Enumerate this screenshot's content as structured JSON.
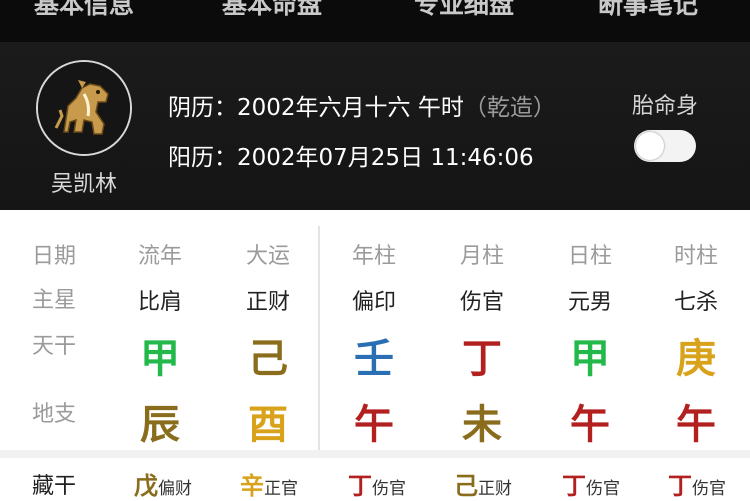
{
  "tabs": [
    "基本信息",
    "基本命盘",
    "专业细盘",
    "断事笔记"
  ],
  "profile": {
    "name": "吴凯林",
    "lunar_label": "阴历：",
    "lunar_value": "2002年六月十六 午时",
    "gender_tag": "（乾造）",
    "solar_label": "阳历：",
    "solar_value": "2002年07月25日 11:46:06",
    "toggle_label": "胎命身",
    "toggle_on": false
  },
  "chart": {
    "headers": [
      "日期",
      "流年",
      "大运",
      "年柱",
      "月柱",
      "日柱",
      "时柱"
    ],
    "row_labels": {
      "main_star": "主星",
      "tian_gan": "天干",
      "di_zhi": "地支",
      "cang_gan": "藏干"
    },
    "main_stars": [
      "比肩",
      "正财",
      "偏印",
      "伤官",
      "元男",
      "七杀"
    ],
    "stems": [
      {
        "char": "甲",
        "color": "#22b84a"
      },
      {
        "char": "己",
        "color": "#8a6d1c"
      },
      {
        "char": "壬",
        "color": "#2a6fb3"
      },
      {
        "char": "丁",
        "color": "#b32020"
      },
      {
        "char": "甲",
        "color": "#22b84a"
      },
      {
        "char": "庚",
        "color": "#d9a21b"
      }
    ],
    "branches": [
      {
        "char": "辰",
        "color": "#8a6d1c"
      },
      {
        "char": "酉",
        "color": "#d9a21b"
      },
      {
        "char": "午",
        "color": "#b32020"
      },
      {
        "char": "未",
        "color": "#8a6d1c"
      },
      {
        "char": "午",
        "color": "#b32020"
      },
      {
        "char": "午",
        "color": "#b32020"
      }
    ],
    "hidden": [
      {
        "stem": "戊",
        "god": "偏财",
        "color": "#8a6d1c"
      },
      {
        "stem": "辛",
        "god": "正官",
        "color": "#d9a21b"
      },
      {
        "stem": "丁",
        "god": "伤官",
        "color": "#b32020"
      },
      {
        "stem": "己",
        "god": "正财",
        "color": "#8a6d1c"
      },
      {
        "stem": "丁",
        "god": "伤官",
        "color": "#b32020"
      },
      {
        "stem": "丁",
        "god": "伤官",
        "color": "#b32020"
      }
    ]
  }
}
